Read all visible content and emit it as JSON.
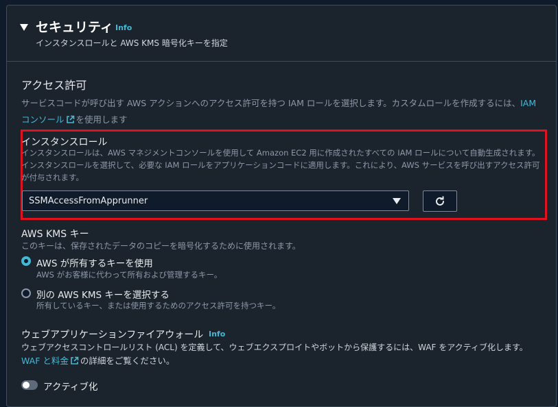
{
  "header": {
    "title": "セキュリティ",
    "info": "Info",
    "description": "インスタンスロールと AWS KMS 暗号化キーを指定"
  },
  "access": {
    "title": "アクセス許可",
    "desc_before_link": "サービスコードが呼び出す AWS アクションへのアクセス許可を持つ IAM ロールを選択します。カスタムロールを作成するには、",
    "link": "IAM コンソール",
    "desc_after_link": "を使用します"
  },
  "instance_role": {
    "label": "インスタンスロール",
    "description": "インスタンスロールは、AWS マネジメントコンソールを使用して Amazon EC2 用に作成されたすべての IAM ロールについて自動生成されます。インスタンスロールを選択して、必要な IAM ロールをアプリケーションコードに適用します。これにより、AWS サービスを呼び出すアクセス許可が付与されます。",
    "selected": "SSMAccessFromApprunner"
  },
  "kms": {
    "label": "AWS KMS キー",
    "description": "このキーは、保存されたデータのコピーを暗号化するために使用されます。",
    "options": [
      {
        "label": "AWS が所有するキーを使用",
        "description": "AWS がお客様に代わって所有および管理するキー。",
        "selected": true
      },
      {
        "label": "別の AWS KMS キーを選択する",
        "description": "所有しているキー、または使用するためのアクセス許可を持つキー。",
        "selected": false
      }
    ]
  },
  "waf": {
    "label": "ウェブアプリケーションファイアウォール",
    "info": "Info",
    "description": "ウェブアクセスコントロールリスト (ACL) を定義して、ウェブエクスプロイトやボットから保護するには、WAF をアクティブ化します。",
    "link": "WAF と料金",
    "link_suffix": "の詳細をご覧ください。",
    "toggle_label": "アクティブ化",
    "toggle_on": false
  },
  "colors": {
    "accent": "#44b9d6",
    "highlight_box": "#e0121f",
    "panel_bg": "#1b232d"
  }
}
